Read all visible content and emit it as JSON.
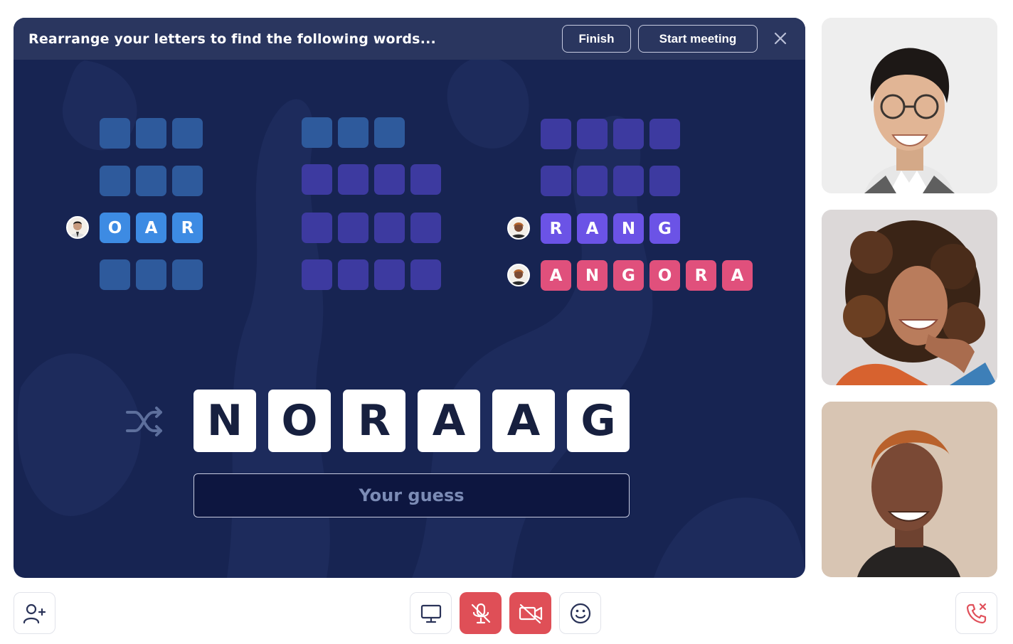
{
  "header": {
    "title": "Rearrange your letters to find the following words...",
    "finish_label": "Finish",
    "start_meeting_label": "Start meeting"
  },
  "puzzle": {
    "groups": [
      {
        "word_length": 3,
        "color": "blue",
        "rows": [
          {
            "letters": [],
            "player": null
          },
          {
            "letters": [],
            "player": null
          },
          {
            "letters": [
              "O",
              "A",
              "R"
            ],
            "player": "man-with-glasses"
          },
          {
            "letters": [],
            "player": null
          }
        ]
      },
      {
        "word_lengths": [
          3,
          4,
          4,
          4
        ],
        "color": "purple",
        "rows": [
          {
            "letters": [],
            "player": null
          },
          {
            "letters": [],
            "player": null
          },
          {
            "letters": [],
            "player": null
          },
          {
            "letters": [],
            "player": null
          }
        ]
      },
      {
        "color": "violet",
        "rows": [
          {
            "letters": [],
            "player": null
          },
          {
            "letters": [],
            "player": null
          },
          {
            "letters": [
              "R",
              "A",
              "N",
              "G"
            ],
            "player": "woman"
          },
          {
            "letters": [
              "A",
              "N",
              "G",
              "O",
              "R",
              "A"
            ],
            "player": "woman"
          }
        ]
      }
    ],
    "scrambled_letters": [
      "N",
      "O",
      "R",
      "A",
      "A",
      "G"
    ],
    "guess_placeholder": "Your guess"
  },
  "participants": [
    {
      "name_hint": "man-with-glasses",
      "bg": "#eeeeee"
    },
    {
      "name_hint": "curly-haired-woman",
      "bg": "#dad6d6"
    },
    {
      "name_hint": "woman-short-hair",
      "bg": "#d6c4b3"
    }
  ],
  "controls": {
    "left": [
      "add-person-icon"
    ],
    "center": [
      "screen-share-icon",
      "mic-muted-icon",
      "camera-off-icon",
      "emoji-icon"
    ],
    "right": [
      "end-call-icon"
    ]
  },
  "colors": {
    "panel_bg": "#172452",
    "header_bg": "#2a365f",
    "blue_empty": "#2e5a9c",
    "purple_empty": "#3d3aa0",
    "blue_fill": "#3d8be3",
    "violet_fill": "#6b53e6",
    "pink_fill": "#e0507c",
    "danger": "#df4f57"
  }
}
